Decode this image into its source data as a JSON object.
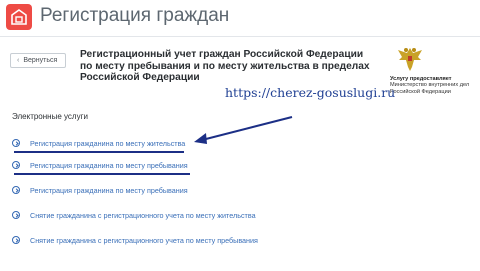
{
  "header": {
    "title": "Регистрация граждан",
    "logo_icon": "house-icon",
    "accent_color": "#ee4b45"
  },
  "back_button": {
    "label": "Вернуться",
    "icon": "chevron-left-icon"
  },
  "service": {
    "title": "Регистрационный учет граждан Российской Федерации по месту пребывания и по месту жительства в пределах Российской Федерации"
  },
  "provider": {
    "label": "Услугу предоставляет",
    "name": "Министерство внутренних дел Российской Федерации",
    "emblem_icon": "double-headed-eagle-emblem"
  },
  "watermark": "https://cherez-gosuslugi.ru",
  "electronic_services": {
    "heading": "Электронные услуги",
    "items": [
      {
        "label": "Регистрация гражданина по месту жительства"
      },
      {
        "label": "Регистрация гражданина по месту пребывания"
      },
      {
        "label": "Регистрация гражданина по месту пребывания"
      },
      {
        "label": "Снятие гражданина с регистрационного учета по месту жительства"
      },
      {
        "label": "Снятие гражданина с регистрационного учета по месту пребывания"
      }
    ]
  },
  "colors": {
    "link": "#3a6fb8",
    "annotation": "#1c2f86"
  }
}
